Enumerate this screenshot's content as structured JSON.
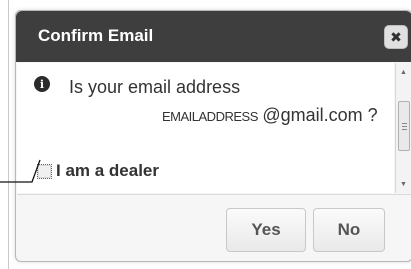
{
  "dialog": {
    "title": "Confirm Email",
    "close_glyph": "✖",
    "question": "Is your email address",
    "email_placeholder": "EMAILADDRESS",
    "email_domain": "@gmail.com ?",
    "dealer_label": "I am a dealer",
    "dealer_checked": false,
    "yes_label": "Yes",
    "no_label": "No",
    "info_glyph": "i"
  },
  "colors": {
    "titlebar": "#3e3e3e",
    "title_text": "#ffffff",
    "dialog_bg": "#f6f6f6",
    "content_bg": "#ffffff",
    "text": "#333333"
  },
  "icons": [
    "info-icon",
    "close-icon",
    "scroll-up-icon",
    "scroll-down-icon"
  ]
}
